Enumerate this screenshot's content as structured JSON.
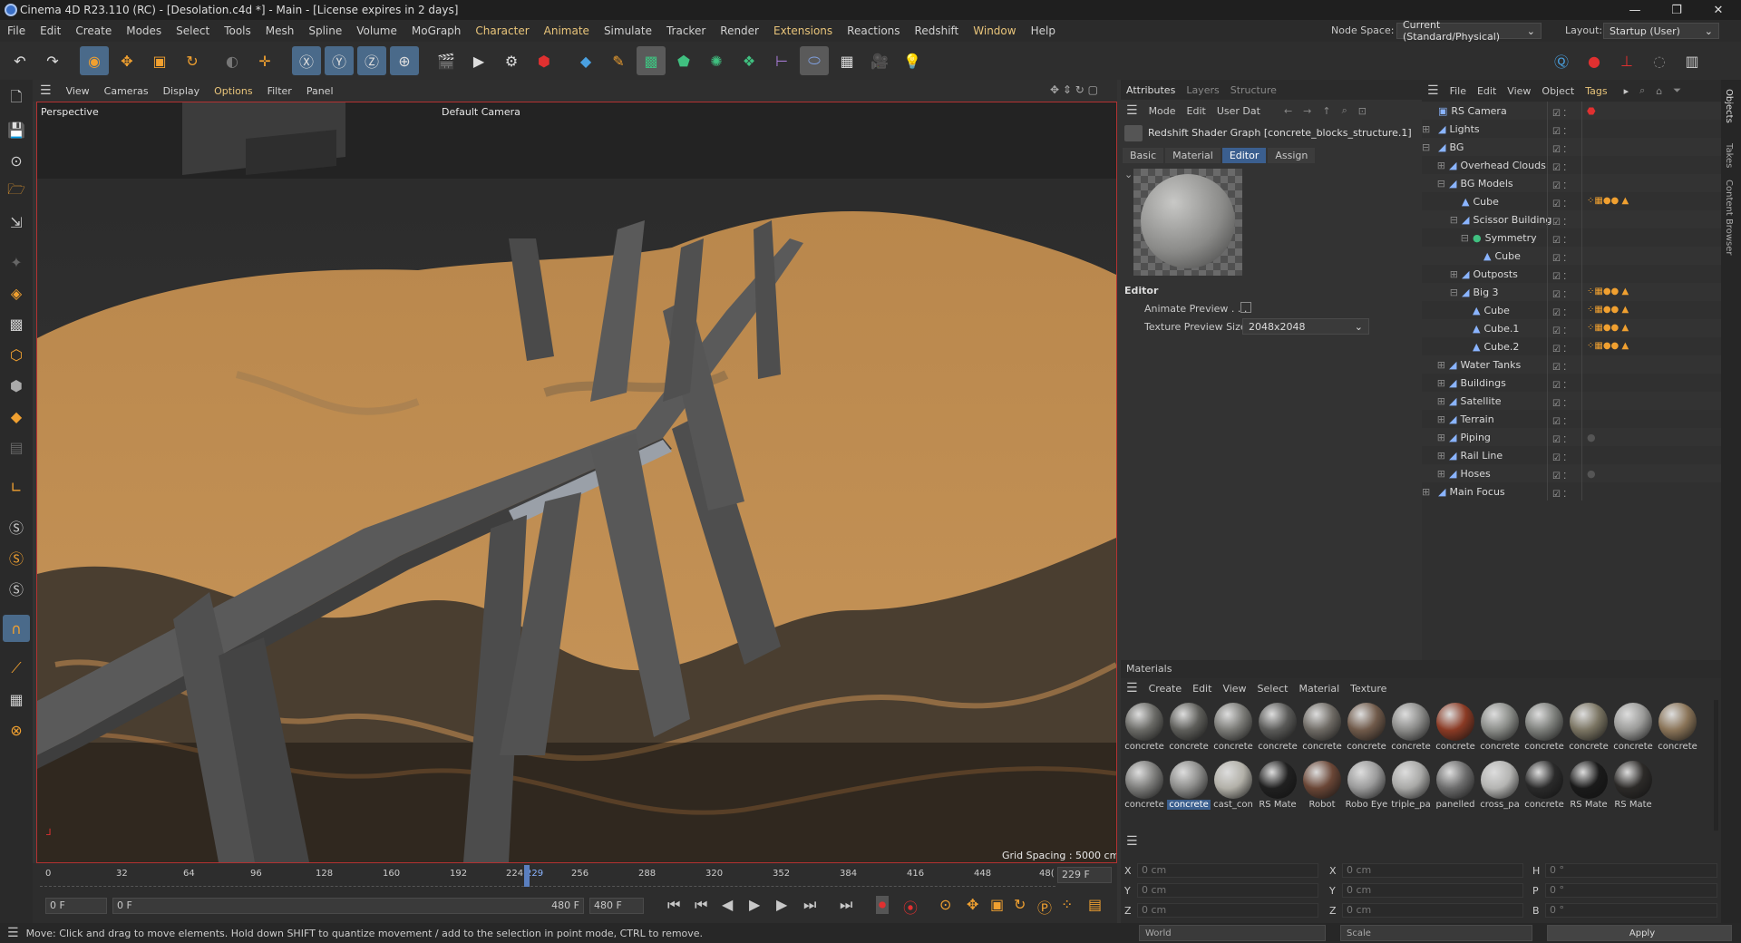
{
  "window": {
    "title": "Cinema 4D R23.110 (RC) - [Desolation.c4d *] - Main - [License expires in 2 days]"
  },
  "menu": [
    "File",
    "Edit",
    "Create",
    "Modes",
    "Select",
    "Tools",
    "Mesh",
    "Spline",
    "Volume",
    "MoGraph",
    "Character",
    "Animate",
    "Simulate",
    "Tracker",
    "Render",
    "Extensions",
    "Reactions",
    "Redshift",
    "Window",
    "Help"
  ],
  "node_space": {
    "label": "Node Space:",
    "value": "Current (Standard/Physical)"
  },
  "layout": {
    "label": "Layout:",
    "value": "Startup (User)"
  },
  "viewport": {
    "menu": [
      "View",
      "Cameras",
      "Display",
      "Options",
      "Filter",
      "Panel"
    ],
    "mode": "Perspective",
    "camera": "Default Camera",
    "grid": "Grid Spacing : 5000 cm"
  },
  "timeline": {
    "ticks": [
      "0",
      "32",
      "64",
      "96",
      "128",
      "160",
      "192",
      "224",
      "229",
      "256",
      "288",
      "320",
      "352",
      "384",
      "416",
      "448",
      "48("
    ],
    "current": "229 F",
    "start": "0 F",
    "range_start": "0 F",
    "range_end": "480 F",
    "end": "480 F"
  },
  "attributes": {
    "tabs": [
      "Attributes",
      "Layers",
      "Structure"
    ],
    "menu": [
      "Mode",
      "Edit",
      "User Dat"
    ],
    "object": "Redshift Shader Graph [concrete_blocks_structure.1]",
    "subtabs": [
      "Basic",
      "Material",
      "Editor",
      "Assign"
    ],
    "section": "Editor",
    "animate_preview": "Animate Preview . . .",
    "texture_preview_label": "Texture Preview Size",
    "texture_preview_value": "2048x2048"
  },
  "objects": {
    "menu": [
      "File",
      "Edit",
      "View",
      "Object",
      "Tags"
    ],
    "rows": [
      {
        "name": "RS Camera",
        "indent": 0
      },
      {
        "name": "Lights",
        "indent": 0
      },
      {
        "name": "BG",
        "indent": 0
      },
      {
        "name": "Overhead Clouds",
        "indent": 1
      },
      {
        "name": "BG Models",
        "indent": 1
      },
      {
        "name": "Cube",
        "indent": 2
      },
      {
        "name": "Scissor Building",
        "indent": 2
      },
      {
        "name": "Symmetry",
        "indent": 3
      },
      {
        "name": "Cube",
        "indent": 4
      },
      {
        "name": "Outposts",
        "indent": 2
      },
      {
        "name": "Big 3",
        "indent": 2
      },
      {
        "name": "Cube",
        "indent": 3
      },
      {
        "name": "Cube.1",
        "indent": 3
      },
      {
        "name": "Cube.2",
        "indent": 3
      },
      {
        "name": "Water Tanks",
        "indent": 1
      },
      {
        "name": "Buildings",
        "indent": 1
      },
      {
        "name": "Satellite",
        "indent": 1
      },
      {
        "name": "Terrain",
        "indent": 1
      },
      {
        "name": "Piping",
        "indent": 1
      },
      {
        "name": "Rail Line",
        "indent": 1
      },
      {
        "name": "Hoses",
        "indent": 1
      },
      {
        "name": "Main Focus",
        "indent": 0
      }
    ]
  },
  "right_tabs": [
    "Objects",
    "Takes",
    "Content Browser"
  ],
  "materials": {
    "title": "Materials",
    "menu": [
      "Create",
      "Edit",
      "View",
      "Select",
      "Material",
      "Texture"
    ],
    "row1": [
      {
        "label": "concrete",
        "color": "#6a6a66"
      },
      {
        "label": "concrete",
        "color": "#5e5e5a"
      },
      {
        "label": "concrete",
        "color": "#7a7a76"
      },
      {
        "label": "concrete",
        "color": "#5a5a58"
      },
      {
        "label": "concrete",
        "color": "#6e6a64"
      },
      {
        "label": "concrete",
        "color": "#705a4a"
      },
      {
        "label": "concrete",
        "color": "#8a8a88"
      },
      {
        "label": "concrete",
        "color": "#8a3a24"
      },
      {
        "label": "concrete",
        "color": "#8a8c88"
      },
      {
        "label": "concrete",
        "color": "#7c7e7a"
      },
      {
        "label": "concrete",
        "color": "#7a7462"
      },
      {
        "label": "concrete",
        "color": "#9a9a98"
      },
      {
        "label": "concrete",
        "color": "#8a7458"
      }
    ],
    "row2": [
      {
        "label": "concrete",
        "color": "#7c7c7a"
      },
      {
        "label": "concrete",
        "color": "#8c8c8a"
      },
      {
        "label": "cast_con",
        "color": "#b2b0a8"
      },
      {
        "label": "RS Mate",
        "color": "#202020"
      },
      {
        "label": "Robot",
        "color": "#6a4636"
      },
      {
        "label": "Robo Eye",
        "color": "#9a9a9a"
      },
      {
        "label": "triple_pa",
        "color": "#a8a8a6"
      },
      {
        "label": "panelled",
        "color": "#6c6c6c"
      },
      {
        "label": "cross_pa",
        "color": "#b4b4b2"
      },
      {
        "label": "concrete",
        "color": "#2a2a2a"
      },
      {
        "label": "RS Mate",
        "color": "#1a1a1a"
      },
      {
        "label": "RS Mate",
        "color": "#2c2a28"
      }
    ]
  },
  "coords": {
    "x": "0 cm",
    "y": "0 cm",
    "z": "0 cm",
    "px": "0 cm",
    "py": "0 cm",
    "pz": "0 cm",
    "h": "0 °",
    "p": "0 °",
    "b": "0 °",
    "mode1": "World",
    "mode2": "Scale",
    "apply": "Apply"
  },
  "status": "Move: Click and drag to move elements. Hold down SHIFT to quantize movement / add to the selection in point mode, CTRL to remove."
}
